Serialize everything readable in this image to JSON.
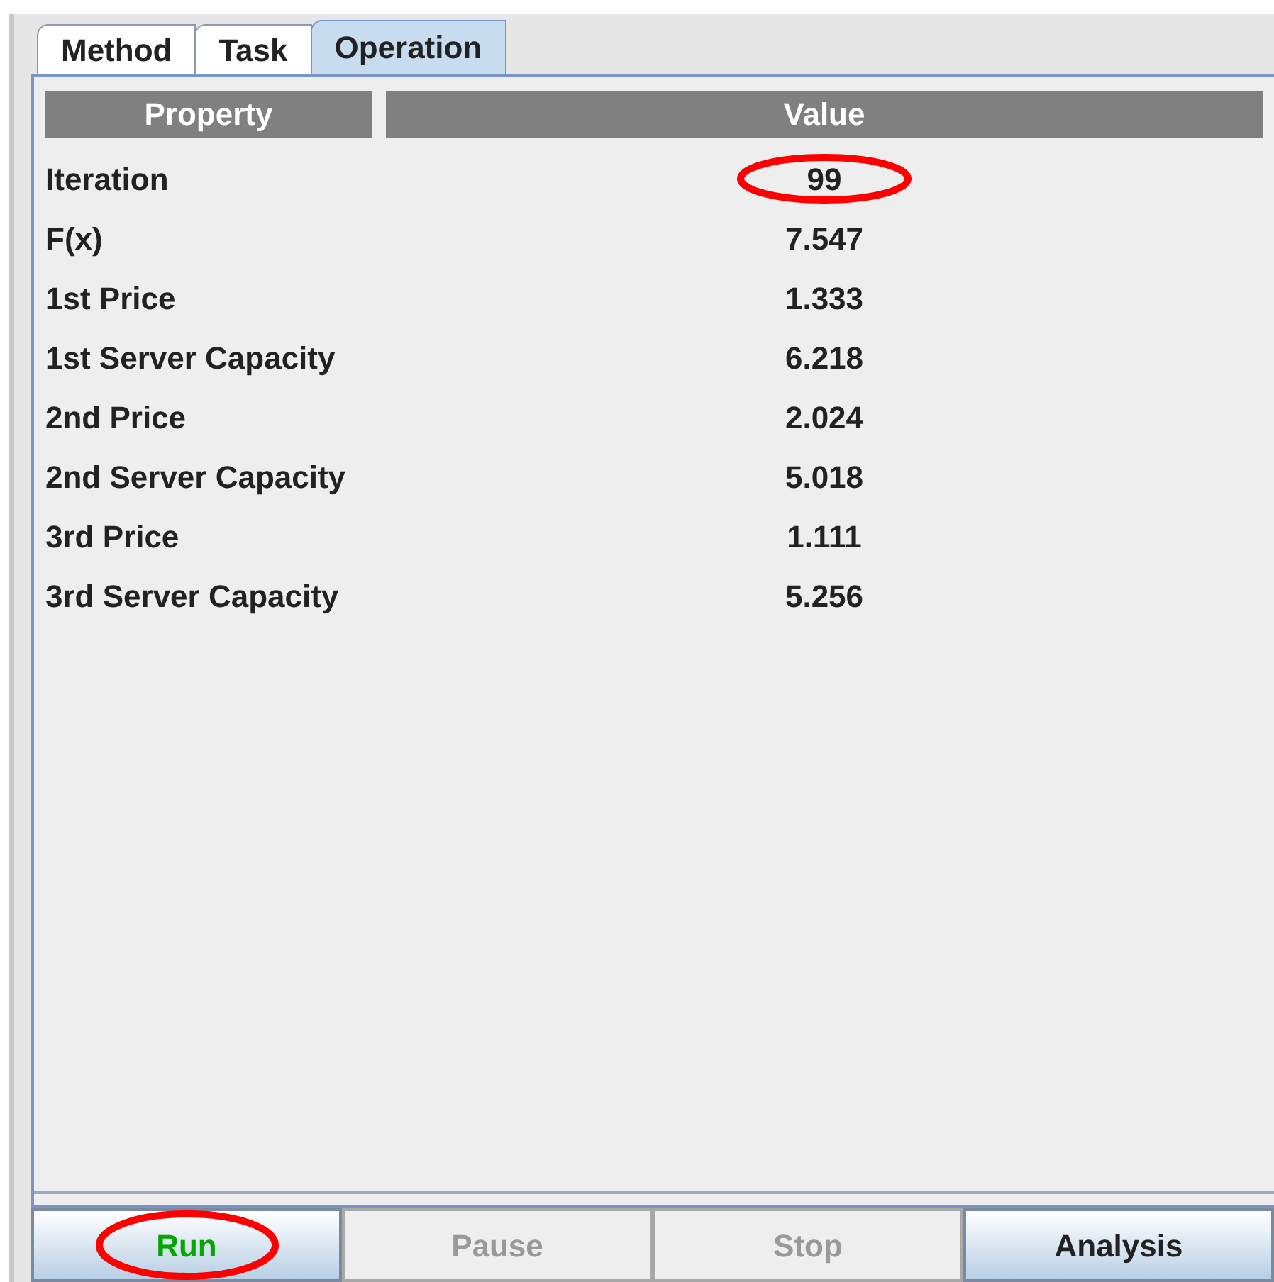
{
  "tabs": [
    {
      "label": "Method",
      "selected": false
    },
    {
      "label": "Task",
      "selected": false
    },
    {
      "label": "Operation",
      "selected": true
    }
  ],
  "table": {
    "columns": [
      "Property",
      "Value"
    ],
    "rows": [
      {
        "property": "Iteration",
        "value": "99",
        "highlighted": true
      },
      {
        "property": "F(x)",
        "value": "7.547",
        "highlighted": false
      },
      {
        "property": "1st Price",
        "value": "1.333",
        "highlighted": false
      },
      {
        "property": "1st Server Capacity",
        "value": "6.218",
        "highlighted": false
      },
      {
        "property": "2nd Price",
        "value": "2.024",
        "highlighted": false
      },
      {
        "property": "2nd Server Capacity",
        "value": "5.018",
        "highlighted": false
      },
      {
        "property": "3rd Price",
        "value": "1.111",
        "highlighted": false
      },
      {
        "property": "3rd Server Capacity",
        "value": "5.256",
        "highlighted": false
      }
    ]
  },
  "buttons": [
    {
      "label": "Run",
      "disabled": false,
      "highlighted": true,
      "color": "#00a800"
    },
    {
      "label": "Pause",
      "disabled": true,
      "highlighted": false,
      "color": "#999999"
    },
    {
      "label": "Stop",
      "disabled": true,
      "highlighted": false,
      "color": "#999999"
    },
    {
      "label": "Analysis",
      "disabled": false,
      "highlighted": false,
      "color": "#222222"
    }
  ]
}
